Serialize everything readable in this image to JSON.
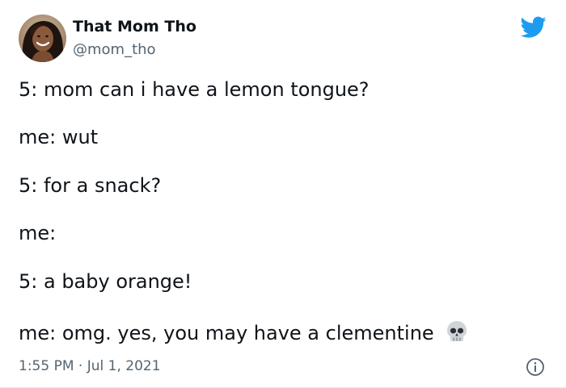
{
  "tweet": {
    "author": {
      "name": "That Mom Tho",
      "handle": "@mom_tho",
      "avatar": "avatar-photo"
    },
    "brand_icon": "twitter-bird-icon",
    "lines": [
      "5: mom can i have a lemon tongue?",
      "me: wut",
      "5: for a snack?",
      "me:",
      "5: a baby orange!",
      "me: omg. yes, you may have a clementine"
    ],
    "emoji": "skull-emoji",
    "timestamp": "1:55 PM · Jul 1, 2021",
    "info_icon": "info-icon",
    "colors": {
      "brand": "#1d9bf0",
      "text_primary": "#0f1419",
      "text_secondary": "#536471"
    }
  }
}
